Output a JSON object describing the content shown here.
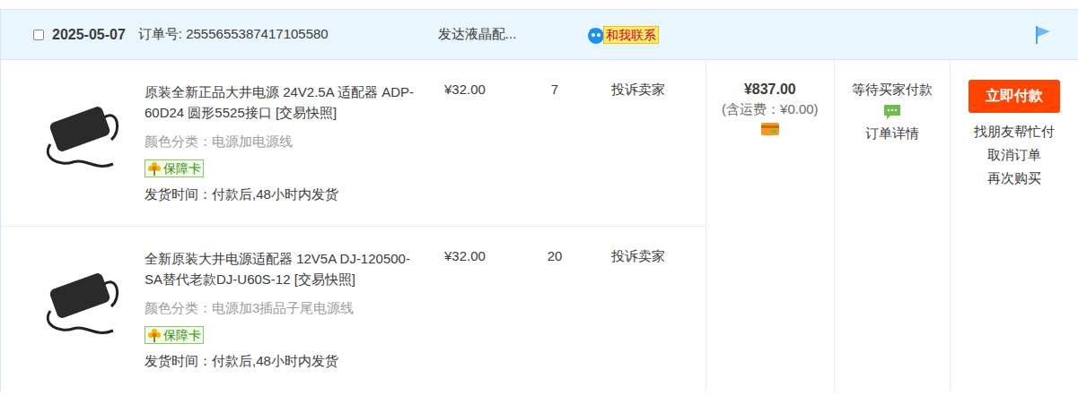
{
  "order": {
    "selected": false,
    "date": "2025-05-07",
    "order_no_label": "订单号:",
    "order_no": "2555655387417105580",
    "shop": "发达液晶配...",
    "contact": "和我联系"
  },
  "items": [
    {
      "title": "原装全新正品大井电源 24V2.5A 适配器 ADP-60D24 圆形5525接口 [交易快照]",
      "spec": "颜色分类：电源加电源线",
      "badge": "保障卡",
      "ship": "发货时间：付款后,48小时内发货",
      "price": "¥32.00",
      "qty": "7",
      "complain": "投诉卖家"
    },
    {
      "title": "全新原装大井电源适配器 12V5A DJ-120500-SA替代老款DJ-U60S-12 [交易快照]",
      "spec": "颜色分类：电源加3插品子尾电源线",
      "badge": "保障卡",
      "ship": "发货时间：付款后,48小时内发货",
      "price": "¥32.00",
      "qty": "20",
      "complain": "投诉卖家"
    }
  ],
  "summary": {
    "total": "¥837.00",
    "shipping": "(含运费：¥0.00)"
  },
  "status": {
    "text": "等待买家付款",
    "detail": "订单详情"
  },
  "actions": {
    "pay": "立即付款",
    "links": [
      "找朋友帮忙付",
      "取消订单",
      "再次购买"
    ]
  }
}
